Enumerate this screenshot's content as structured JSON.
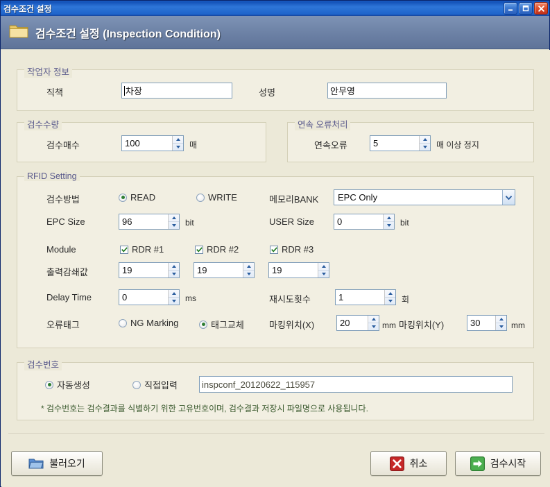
{
  "window": {
    "title": "검수조건 설정",
    "controls": {
      "minimize": "minimize-button",
      "maximize": "maximize-button",
      "close": "close-button"
    }
  },
  "header": {
    "title": "검수조건 설정 (Inspection Condition)",
    "icon": "folder-icon"
  },
  "worker": {
    "caption": "작업자 정보",
    "position_label": "직책",
    "position_value": "차장",
    "name_label": "성명",
    "name_value": "안무영"
  },
  "quantity": {
    "caption": "검수수량",
    "count_label": "검수매수",
    "count_value": "100",
    "unit": "매"
  },
  "error_handling": {
    "caption": "연속 오류처리",
    "label": "연속오류",
    "value": "5",
    "suffix": "매 이상 정지"
  },
  "rfid": {
    "caption": "RFID Setting",
    "method_label": "검수방법",
    "method_read": "READ",
    "method_write": "WRITE",
    "method_selected": "READ",
    "bank_label": "메모리BANK",
    "bank_value": "EPC Only",
    "epc_label": "EPC Size",
    "epc_value": "96",
    "epc_unit": "bit",
    "user_label": "USER Size",
    "user_value": "0",
    "user_unit": "bit",
    "module_label": "Module",
    "modules": [
      {
        "label": "RDR #1",
        "checked": true,
        "attn": "19"
      },
      {
        "label": "RDR #2",
        "checked": true,
        "attn": "19"
      },
      {
        "label": "RDR #3",
        "checked": true,
        "attn": "19"
      }
    ],
    "attn_label": "출력감쇄값",
    "delay_label": "Delay Time",
    "delay_value": "0",
    "delay_unit": "ms",
    "retry_label": "재시도횟수",
    "retry_value": "1",
    "retry_unit": "회",
    "errtag_label": "오류태그",
    "errtag_ng": "NG Marking",
    "errtag_replace": "태그교체",
    "errtag_selected": "태그교체",
    "markx_label": "마킹위치(X)",
    "markx_value": "20",
    "markx_unit": "mm",
    "marky_label": "마킹위치(Y)",
    "marky_value": "30",
    "marky_unit": "mm"
  },
  "inspection_no": {
    "caption": "검수번호",
    "auto_label": "자동생성",
    "manual_label": "직접입력",
    "selected": "자동생성",
    "value": "inspconf_20120622_115957",
    "note": "* 검수번호는 검수결과를 식별하기 위한 고유번호이며, 검수결과 저장시 파일명으로 사용됩니다."
  },
  "buttons": {
    "load": "불러오기",
    "cancel": "취소",
    "start": "검수시작"
  },
  "colors": {
    "titlebar": "#2e76d8",
    "header": "#6d82a6",
    "panel": "#ece9d8",
    "group": "#f2efe2",
    "caption_text": "#5a5a8c",
    "note_text": "#3a5a2e",
    "cancel_icon": "#c62828",
    "start_icon": "#4caf50"
  }
}
